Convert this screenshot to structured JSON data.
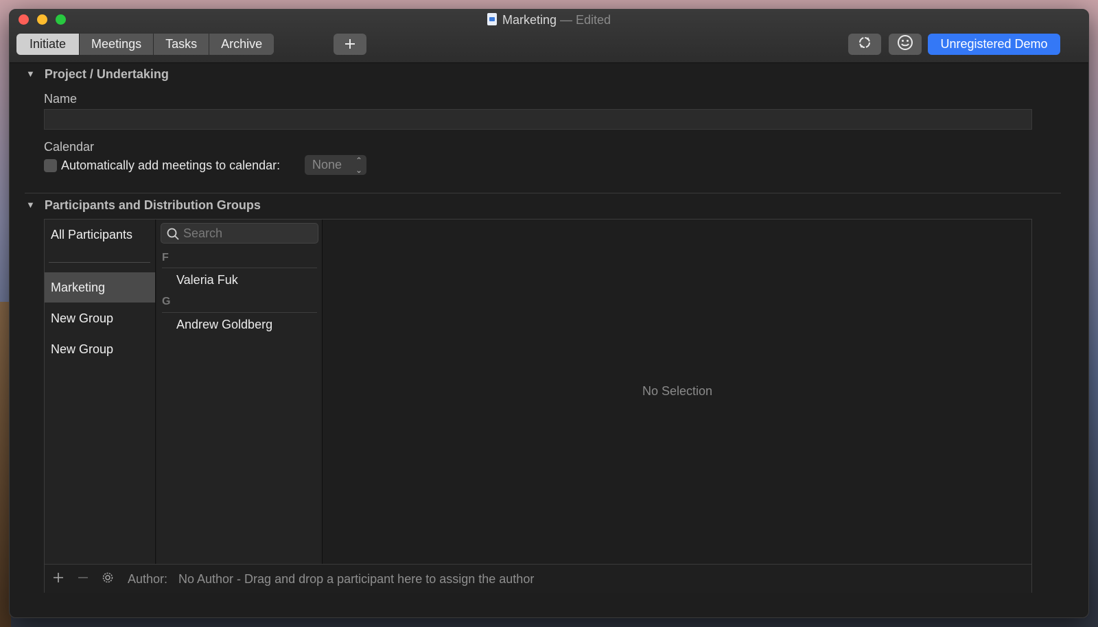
{
  "window": {
    "title": "Marketing",
    "title_suffix": "— Edited"
  },
  "toolbar": {
    "tabs": [
      {
        "label": "Initiate",
        "active": true
      },
      {
        "label": "Meetings"
      },
      {
        "label": "Tasks"
      },
      {
        "label": "Archive"
      }
    ],
    "add_icon": "plus-icon",
    "sync_icon": "sync-icon",
    "feedback_icon": "smiley-icon",
    "demo_label": "Unregistered Demo"
  },
  "project": {
    "section_title": "Project / Undertaking",
    "name_label": "Name",
    "name_value": "",
    "calendar_label": "Calendar",
    "auto_add_label": "Automatically add meetings to calendar:",
    "auto_add_checked": false,
    "calendar_select": "None"
  },
  "participants": {
    "section_title": "Participants and Distribution Groups",
    "groups": [
      {
        "label": "All Participants"
      },
      {
        "label": "Marketing",
        "selected": true
      },
      {
        "label": "New Group"
      },
      {
        "label": "New Group"
      }
    ],
    "search_placeholder": "Search",
    "sections": [
      {
        "letter": "F",
        "people": [
          "Valeria Fuk"
        ]
      },
      {
        "letter": "G",
        "people": [
          "Andrew Goldberg"
        ]
      }
    ],
    "detail_empty": "No Selection",
    "author_label": "Author:",
    "author_value": "No Author - Drag and drop a participant here to assign the author"
  },
  "colors": {
    "accent": "#3478f6",
    "window_bg": "#1e1e1e"
  }
}
